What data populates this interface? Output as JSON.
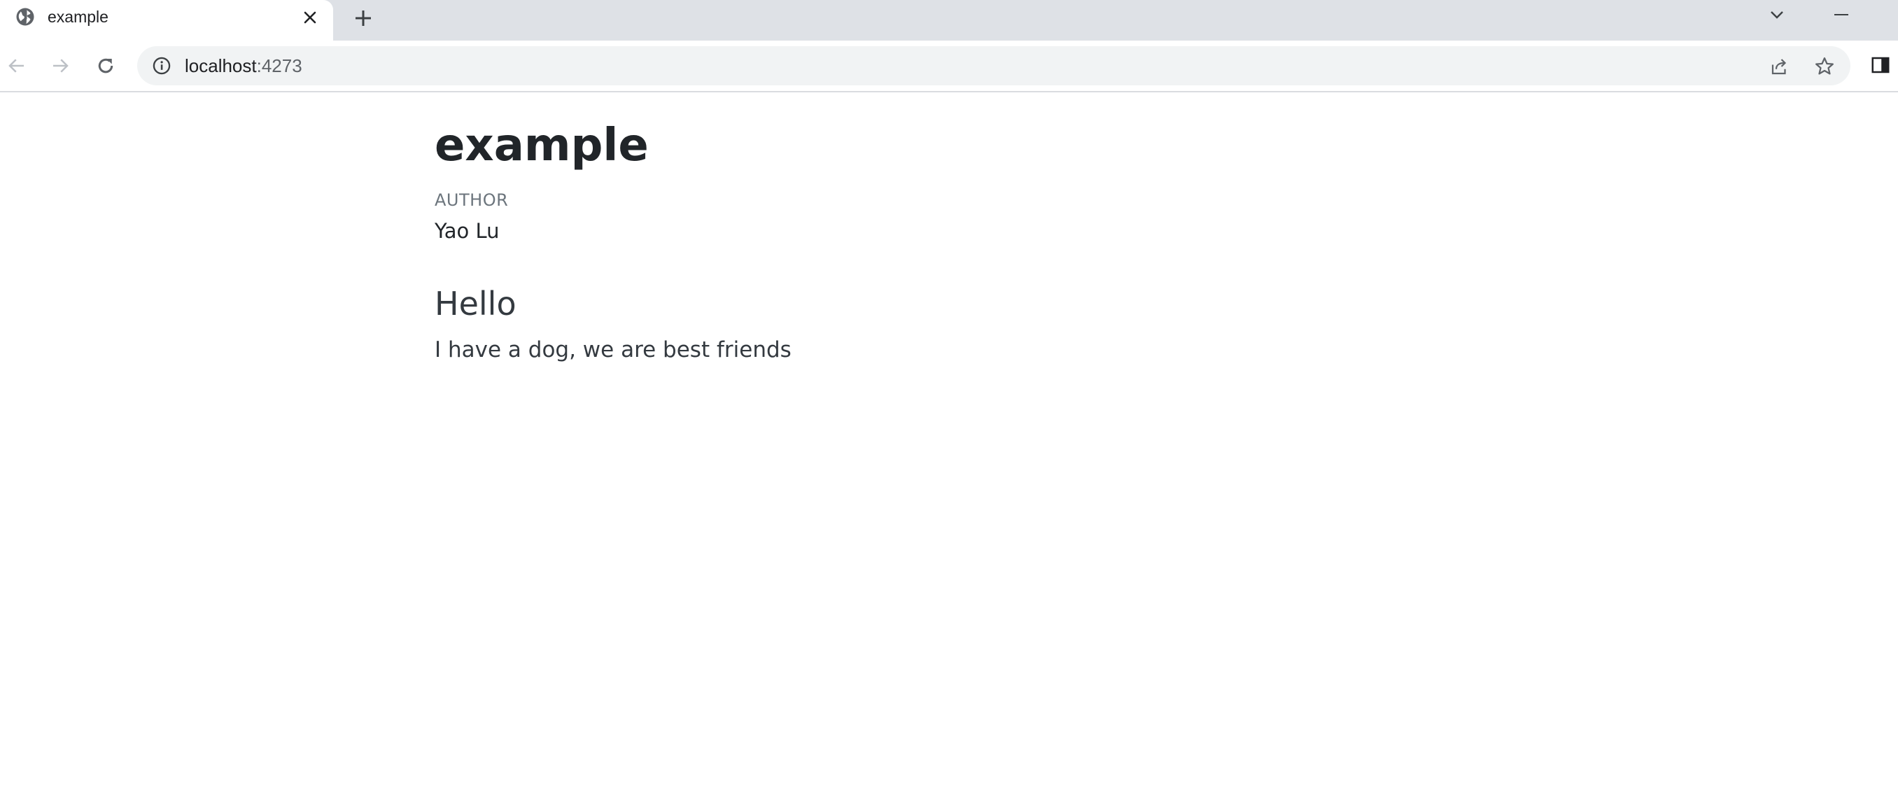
{
  "browser": {
    "tab": {
      "title": "example",
      "favicon": "globe-icon",
      "close_icon": "close-icon"
    },
    "new_tab_icon": "plus-icon",
    "tab_search_icon": "chevron-down-icon",
    "minimize_icon": "minimize-icon",
    "toolbar": {
      "back_icon": "arrow-left-icon",
      "forward_icon": "arrow-right-icon",
      "reload_icon": "reload-icon",
      "side_panel_icon": "side-panel-icon"
    },
    "omnibox": {
      "site_info_icon": "info-icon",
      "host": "localhost",
      "port": ":4273",
      "share_icon": "share-icon",
      "bookmark_icon": "star-icon"
    }
  },
  "page": {
    "title": "example",
    "author_heading": "AUTHOR",
    "author_name": "Yao Lu",
    "section": {
      "heading": "Hello",
      "text": "I have a dog, we are best friends"
    }
  },
  "colors": {
    "tabstrip_bg": "#dee1e6",
    "omnibox_bg": "#f1f3f4",
    "text_primary": "#212529",
    "text_muted": "#6c757d"
  }
}
